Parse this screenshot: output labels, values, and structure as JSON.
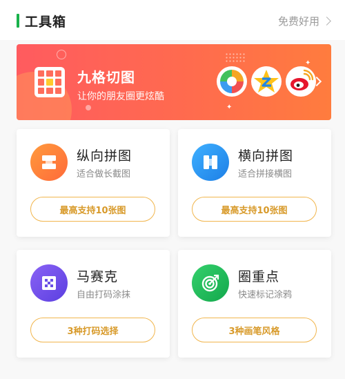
{
  "section": {
    "title": "工具箱",
    "more_label": "免费好用",
    "accent_color": "#19b24b"
  },
  "banner": {
    "title": "九格切图",
    "subtitle": "让你的朋友圈更炫酷",
    "gradient": [
      "#ff5b5f",
      "#ff7c3e"
    ],
    "share_icons": [
      "moments-shutter-icon",
      "qzone-star-icon",
      "weibo-icon"
    ]
  },
  "tools": [
    {
      "title": "纵向拼图",
      "subtitle": "适合做长截图",
      "button": "最高支持10张图",
      "icon": "vertical-stitch-icon",
      "icon_color": "#ff7a3c"
    },
    {
      "title": "横向拼图",
      "subtitle": "适合拼接横图",
      "button": "最高支持10张图",
      "icon": "horizontal-stitch-icon",
      "icon_color": "#2b8ff0"
    },
    {
      "title": "马赛克",
      "subtitle": "自由打码涂抹",
      "button": "3种打码选择",
      "icon": "mosaic-icon",
      "icon_color": "#6a4fe6"
    },
    {
      "title": "圈重点",
      "subtitle": "快速标记涂鸦",
      "button": "3种画笔风格",
      "icon": "target-icon",
      "icon_color": "#1fb95a"
    }
  ],
  "button_color": "#f1b54c"
}
